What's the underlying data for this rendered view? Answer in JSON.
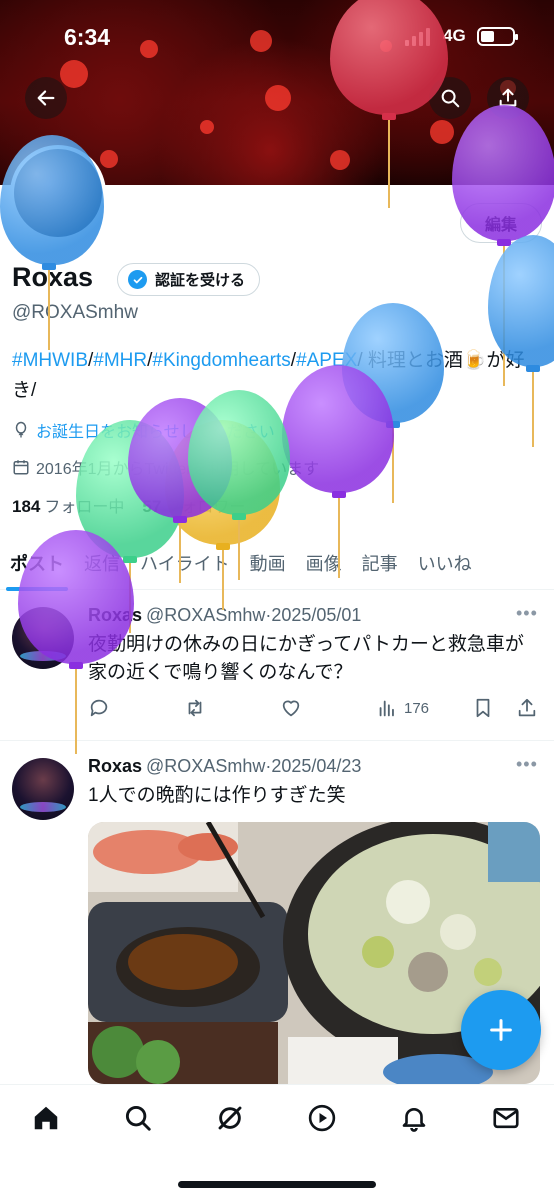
{
  "status_bar": {
    "time": "6:34",
    "network": "4G"
  },
  "profile": {
    "name": "Roxas",
    "verify_label": "認証を受ける",
    "edit_label": "編集",
    "handle": "@ROXASmhw",
    "bio_tags": [
      "#MHWIB",
      "#MHR",
      "#Kingdomhearts",
      "#APEX"
    ],
    "bio_text": "料理とお酒🍺が好き/",
    "birthday": "お誕生日をお知らせしてください",
    "joined": "2016年1月からTwitterを利用しています",
    "following_count": "184",
    "following_label": "フォロー中",
    "followers_count": "57",
    "followers_label": "フォロワー"
  },
  "tabs": [
    "ポスト",
    "返信",
    "ハイライト",
    "動画",
    "画像",
    "記事",
    "いいね"
  ],
  "posts": [
    {
      "author": "Roxas",
      "handle": "@ROXASmhw",
      "date": "2025/05/01",
      "text": "夜勤明けの休みの日にかぎってパトカーと救急車が家の近くで鳴り響くのなんで？",
      "views": "176"
    },
    {
      "author": "Roxas",
      "handle": "@ROXASmhw",
      "date": "2025/04/23",
      "text": "1人での晩酌には作りすぎた笑"
    }
  ],
  "more_label": "•••",
  "separator": "·",
  "colors": {
    "accent": "#1d9bf0",
    "text": "#0f1419",
    "muted": "#536471"
  },
  "icons": [
    "back-arrow-icon",
    "search-icon",
    "share-icon",
    "reply-icon",
    "repost-icon",
    "like-icon",
    "views-icon",
    "bookmark-icon",
    "compose-plus-icon",
    "home-icon",
    "grok-icon",
    "play-icon",
    "bell-icon",
    "mail-icon"
  ]
}
